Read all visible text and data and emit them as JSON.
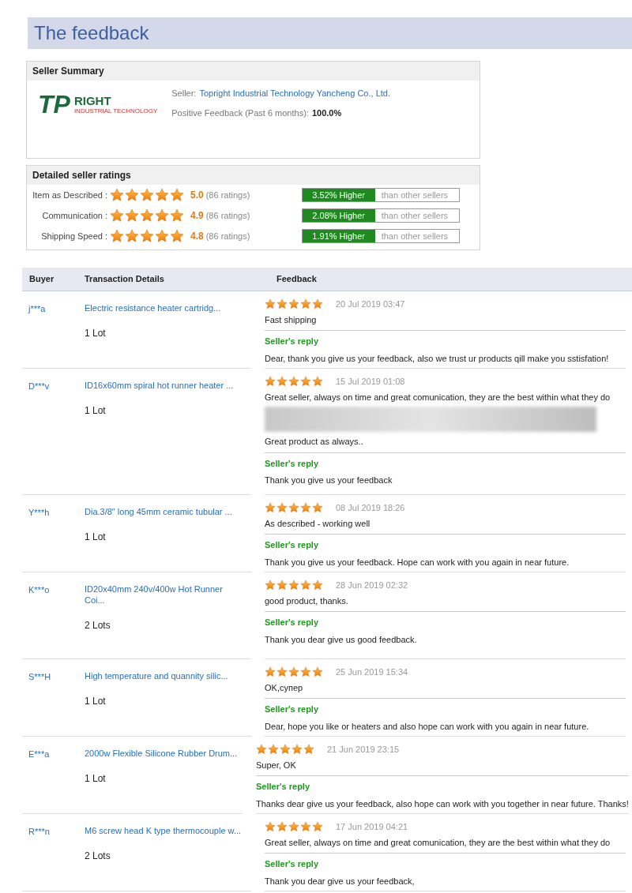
{
  "title": "The feedback",
  "seller_summary": {
    "heading": "Seller Summary",
    "logo": {
      "mark": "TP",
      "word": "RIGHT",
      "tagline": "INDUSTRIAL TECHNOLOGY"
    },
    "seller_label": "Seller:",
    "seller_name": "Topright Industrial Technology Yancheng Co., Ltd.",
    "positive_label": "Positive Feedback (Past 6 months):",
    "positive_value": "100.0%"
  },
  "detailed_ratings": {
    "heading": "Detailed seller ratings",
    "rows": [
      {
        "label": "Item as Described :",
        "stars": 5,
        "score": "5.0",
        "count": "(86 ratings)",
        "compare": "3.52% Higher",
        "compare_note": "than other sellers"
      },
      {
        "label": "Communication :",
        "stars": 5,
        "score": "4.9",
        "count": "(86 ratings)",
        "compare": "2.08% Higher",
        "compare_note": "than other sellers"
      },
      {
        "label": "Shipping Speed :",
        "stars": 5,
        "score": "4.8",
        "count": "(86 ratings)",
        "compare": "1.91% Higher",
        "compare_note": "than other sellers"
      }
    ]
  },
  "table": {
    "columns": [
      "Buyer",
      "Transaction Details",
      "Feedback"
    ],
    "rows": [
      {
        "buyer": "j***a",
        "product": "Electric resistance heater cartridg...",
        "quantity": "1 Lot",
        "stars": 5,
        "date": "20 Jul 2019 03:47",
        "feedback": [
          "Fast shipping"
        ],
        "blurred": false,
        "reply_label": "Seller's reply",
        "reply": "Dear, thank you give us your feedback, also we trust ur products qill make you sstisfation!"
      },
      {
        "buyer": "D***v",
        "product": "ID16x60mm spiral hot runner heater ...",
        "quantity": "1 Lot",
        "stars": 5,
        "date": "15 Jul 2019 01:08",
        "feedback": [
          "Great seller, always on time and great comunication, they are the best within what they do",
          "Great product as always.."
        ],
        "blurred": true,
        "reply_label": "Seller's reply",
        "reply": "Thank you give us your feedback"
      },
      {
        "buyer": "Y***h",
        "product": "Dia.3/8\" long 45mm ceramic tubular ...",
        "quantity": "1 Lot",
        "stars": 5,
        "date": "08 Jul 2019 18:26",
        "feedback": [
          "As described - working well"
        ],
        "blurred": false,
        "reply_label": "Seller's reply",
        "reply": "Thank you give us your feedback. Hope can work with you again in near future."
      },
      {
        "buyer": "K***o",
        "product": "ID20x40mm 240v/400w Hot Runner Coi...",
        "quantity": "2 Lots",
        "stars": 5,
        "date": "28 Jun 2019 02:32",
        "feedback": [
          "good product, thanks."
        ],
        "blurred": false,
        "reply_label": "Seller's reply",
        "reply": "Thank you dear give us good feedback."
      },
      {
        "buyer": "S***H",
        "product": "High temperature and quannity silic...",
        "quantity": "1 Lot",
        "stars": 5,
        "date": "25 Jun 2019 15:34",
        "feedback": [
          "OK,супер"
        ],
        "blurred": false,
        "reply_label": "Seller's reply",
        "reply": "Dear, hope you like or heaters and also hope can work with you again in near future."
      },
      {
        "buyer": "E***a",
        "product": "2000w Flexible Silicone Rubber Drum...",
        "quantity": "1 Lot",
        "stars": 5,
        "date": "21 Jun 2019 23:15",
        "feedback": [
          "Super, OK"
        ],
        "blurred": false,
        "reply_label": "Seller's reply",
        "reply": "Thanks dear give us your feedback, also hope can work with you together in near future. Thanks!"
      },
      {
        "buyer": "R***n",
        "product": "M6 screw head K type thermocouple w...",
        "quantity": "2 Lots",
        "stars": 5,
        "date": "17 Jun 2019 04:21",
        "feedback": [
          "Great seller, always on time and great comunication, they are the best within what they do"
        ],
        "blurred": false,
        "reply_label": "Seller's reply",
        "reply": "Thank you dear give us your feedback,"
      }
    ]
  }
}
